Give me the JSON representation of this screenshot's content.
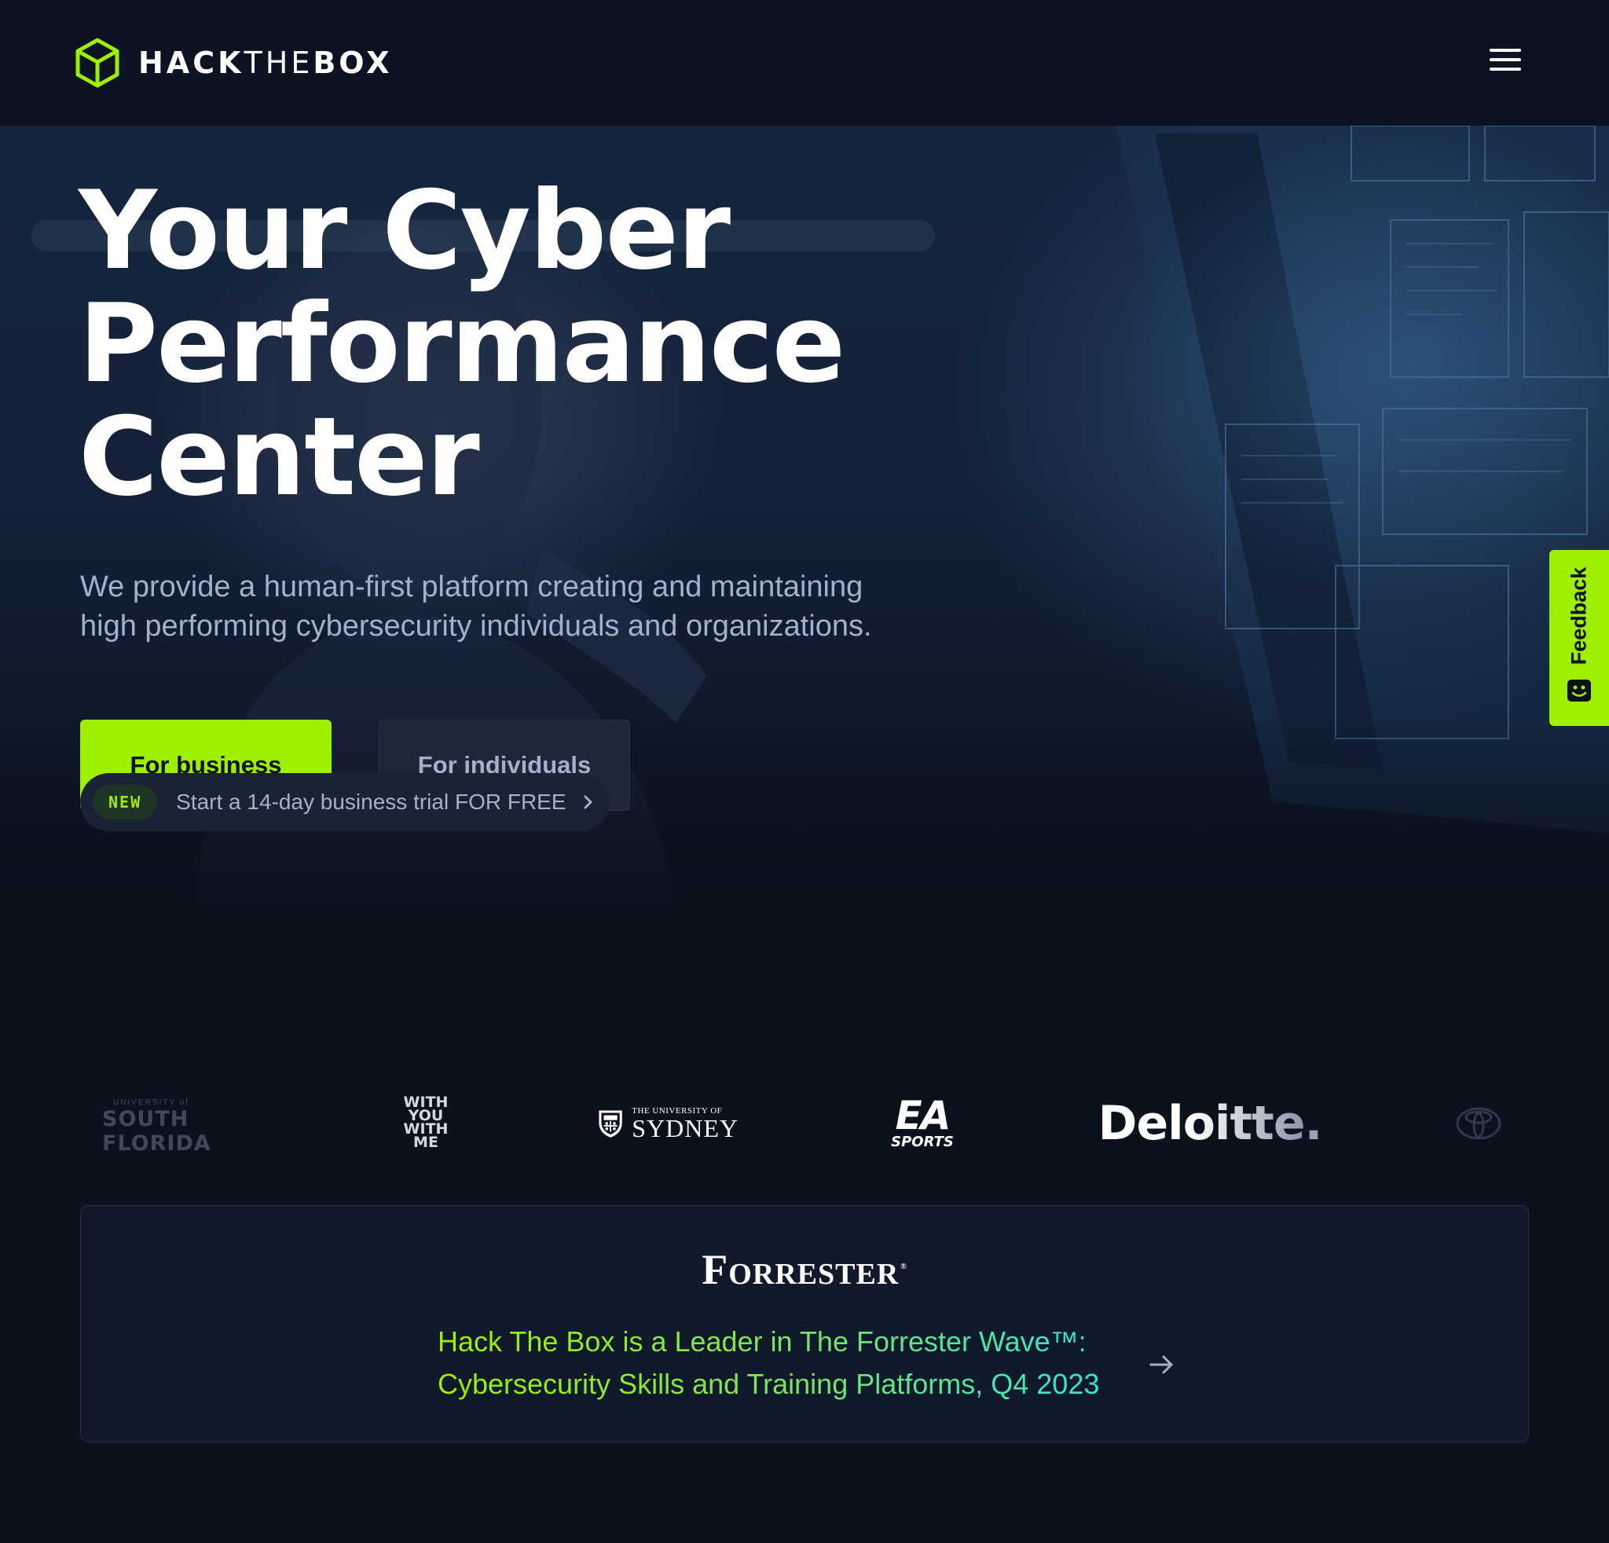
{
  "navbar": {
    "brand": {
      "part1": "HACK",
      "part2": "THE",
      "part3": "BOX"
    },
    "menu_icon": "hamburger-menu-icon"
  },
  "hero": {
    "headline": [
      "Your Cyber",
      "Performance",
      "Center"
    ],
    "subtitle": [
      "We provide a human-first platform creating and maintaining",
      "high performing cybersecurity individuals and organizations."
    ],
    "buttons": {
      "business": "For business",
      "individuals": "For individuals"
    },
    "trial": {
      "badge": "NEW",
      "text": "Start a 14-day business trial FOR FREE"
    }
  },
  "feedback": {
    "label": "Feedback",
    "icon": "feedback-face-icon"
  },
  "partner_logos": {
    "usf": {
      "small": "UNIVERSITY of",
      "big": "SOUTH FLORIDA"
    },
    "wywm": [
      "WITH",
      "YOU",
      "WITH",
      "ME"
    ],
    "sydney": {
      "small": "THE UNIVERSITY OF",
      "big": "SYDNEY"
    },
    "ea": {
      "mark": "EA",
      "sub": "SPORTS"
    },
    "deloitte": {
      "name": "Deloitte",
      "dot": "."
    },
    "toyota": "toyota-logo-icon"
  },
  "forrester": {
    "logo": "Forrester",
    "logo_reg": "®",
    "text": [
      "Hack The Box is a Leader in The Forrester Wave™:",
      "Cybersecurity Skills and Training Platforms, Q4 2023"
    ]
  },
  "colors": {
    "background": "#0b111d",
    "navbar": "#0c1322",
    "accent": "#9fef00",
    "muted_text": "#a4b1cd",
    "secondary_button": "#1d2739",
    "card": "#111a2a",
    "gradient_end": "#2ee6d6"
  }
}
